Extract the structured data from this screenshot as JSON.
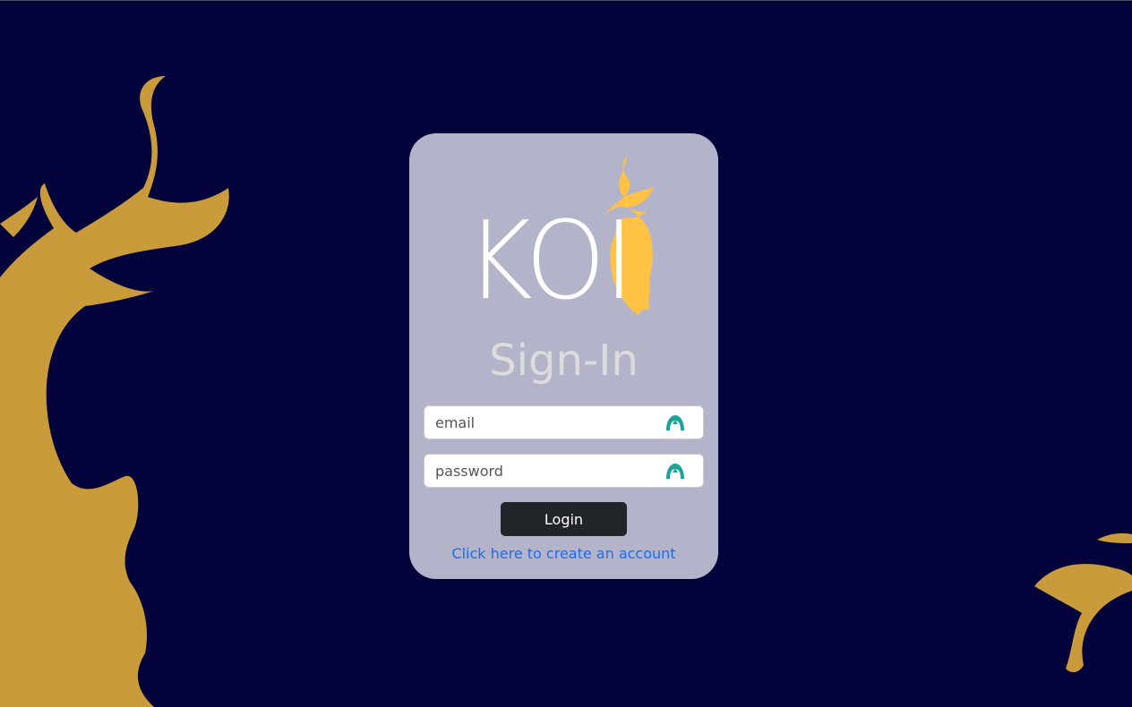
{
  "background_color": "#03023a",
  "accent_gold": "#c99b3a",
  "card": {
    "background": "#b3b4c9",
    "logo_text": "KOI",
    "title": "Sign-In",
    "email": {
      "placeholder": "email",
      "value": ""
    },
    "password": {
      "placeholder": "password",
      "value": ""
    },
    "login_label": "Login",
    "create_account_link": "Click here to create an account"
  },
  "icons": {
    "password_manager": "password-manager-icon",
    "decoration": "koi-fish-icon"
  }
}
